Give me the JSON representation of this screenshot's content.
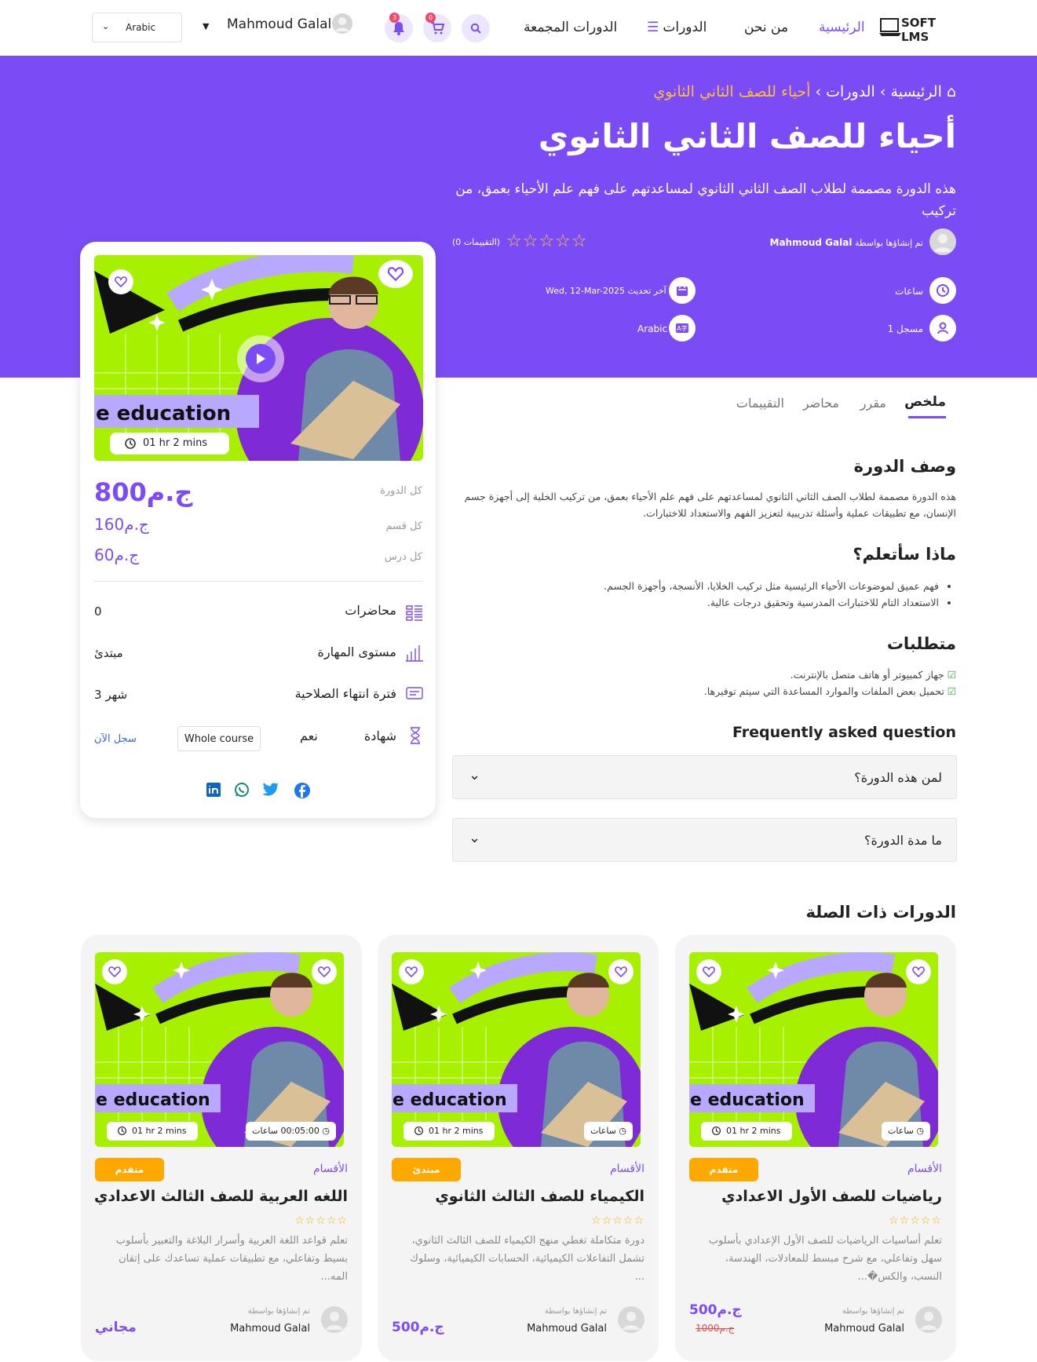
{
  "nav": {
    "logo": "SOFT LMS",
    "home": "الرئيسية",
    "about": "من نحن",
    "courses": "الدورات",
    "bundles": "الدورات المجمعة",
    "user": "Mahmoud Galal",
    "language": "Arabic",
    "notif_count": "3",
    "cart_count": "0"
  },
  "hero": {
    "crumb_home": "الرئيسية",
    "crumb_courses": "الدورات",
    "crumb_current": "أحياء للصف الثاني الثانوي",
    "title": "أحياء للصف الثاني الثانوي",
    "description": "هذه الدورة مصممة لطلاب الصف الثاني الثانوي لمساعدتهم على فهم علم الأحياء بعمق، من تركيب",
    "created_by_label": "تم إنشاؤها بواسطة",
    "author": "Mahmoud Galal",
    "rating_count": "(0 التقييمات)",
    "rating": 0,
    "hours": "ساعات",
    "updated_label": "آخر تحديث",
    "updated_date": "Wed, 12-Mar-2025",
    "enrolled": "1 مسجل",
    "language": "Arabic"
  },
  "sidebar": {
    "duration": "01 hr 2 mins",
    "price_label": "كل الدورة",
    "price": "ج.م800",
    "section_label": "كل قسم",
    "section_price": "ج.م160",
    "lesson_label": "كل درس",
    "lesson_price": "ج.م60",
    "lectures_label": "محاضرات",
    "lectures": "0",
    "level_label": "مستوى المهارة",
    "level": "مبتدئ",
    "expiry_label": "فترة انتهاء الصلاحية",
    "expiry": "3 شهر",
    "certificate_label": "شهادة",
    "certificate": "نعم",
    "whole_course": "Whole course",
    "register": "سجل الآن"
  },
  "tabs": {
    "summary": "ملخص",
    "curriculum": "مقرر",
    "instructor": "محاضر",
    "reviews": "التقييمات"
  },
  "content": {
    "desc_title": "وصف الدورة",
    "desc_text": "هذه الدورة مصممة لطلاب الصف الثاني الثانوي لمساعدتهم على فهم علم الأحياء بعمق، من تركيب الخلية إلى أجهزة جسم الإنسان، مع تطبيقات عملية وأسئلة تدريبية لتعزيز الفهم والاستعداد للاختبارات.",
    "learn_title": "ماذا سأتعلم؟",
    "learn": [
      "فهم عميق لموضوعات الأحياء الرئيسية مثل تركيب الخلايا، الأنسجة، وأجهزة الجسم.",
      "الاستعداد التام للاختبارات المدرسية وتحقيق درجات عالية."
    ],
    "req_title": "متطلبات",
    "reqs": [
      "جهاز كمبيوتر أو هاتف متصل بالإنترنت.",
      "تحميل بعض الملفات والموارد المساعدة التي سيتم توفيرها."
    ],
    "faq_title": "Frequently asked question",
    "faqs": [
      "لمن هذه الدورة؟",
      "ما مدة الدورة؟"
    ]
  },
  "related": {
    "title": "الدورات ذات الصلة",
    "category": "الأقسام",
    "by": "تم إنشاؤها بواسطة",
    "author": "Mahmoud Galal",
    "badge_text": "e education",
    "items": [
      {
        "name": "رياضيات للصف الأول الاعدادي",
        "level": "متقدم",
        "level_color": "#ffa800",
        "duration": "01 hr 2 mins",
        "hours": "ساعات",
        "desc1": "تعلم أساسيات الرياضيات للصف الأول الإعدادي بأسلوب",
        "desc2": "سهل وتفاعلي، مع شرح مبسط للمعادلات، الهندسة،",
        "desc3": "النسب، والكس�...",
        "price": "ج.م500",
        "old_price": "ج.م1000"
      },
      {
        "name": "الكيمياء للصف الثالث الثانوي",
        "level": "مبتدئ",
        "level_color": "#ffa800",
        "duration": "01 hr 2 mins",
        "hours": "ساعات",
        "desc1": "دورة متكاملة تغطي منهج الكيمياء للصف الثالث الثانوي،",
        "desc2": "تشمل التفاعلات الكيميائية، الحسابات الكيميائية، وسلوك",
        "desc3": "...",
        "price": "ج.م500",
        "old_price": ""
      },
      {
        "name": "اللغه العربية للصف الثالث الاعدادي",
        "level": "متقدم",
        "level_color": "#ffa800",
        "duration": "01 hr 2 mins",
        "hours": "00:05:00 ساعات",
        "desc1": "تعلم قواعد اللغة العربية وأسرار البلاغة والتعبير بأسلوب",
        "desc2": "بسيط وتفاعلي، مع تطبيقات عملية تساعدك على إتقان",
        "desc3": "المه...",
        "price": "مجاني",
        "old_price": ""
      }
    ]
  },
  "colors": {
    "primary": "#7b4cf6",
    "accent": "#ffb703",
    "star": "#f5b301"
  }
}
